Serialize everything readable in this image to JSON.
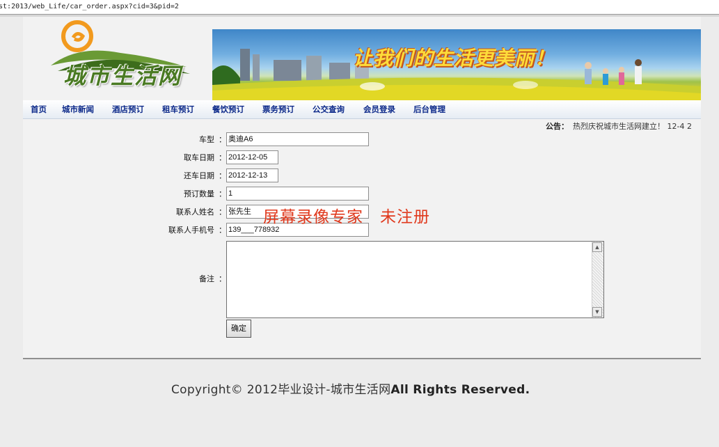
{
  "browser": {
    "address": "ost:2013/web_Life/car_order.aspx?cid=3&pid=2"
  },
  "header": {
    "logo_text": "城市生活网",
    "banner_slogan": "让我们的生活更美丽！"
  },
  "nav": {
    "items": [
      "首页",
      "城市新闻",
      "酒店预订",
      "租车预订",
      "餐饮预订",
      "票务预订",
      "公交查询",
      "会员登录",
      "后台管理"
    ]
  },
  "notice": {
    "label": "公告：",
    "text": "热烈庆祝城市生活网建立！ 12-4 2"
  },
  "form": {
    "colon": "：",
    "car_type": {
      "label": "车型",
      "value": "奥迪A6"
    },
    "pickup_date": {
      "label": "取车日期",
      "value": "2012-12-05"
    },
    "return_date": {
      "label": "还车日期",
      "value": "2012-12-13"
    },
    "quantity": {
      "label": "预订数量",
      "value": "1"
    },
    "contact_name": {
      "label": "联系人姓名",
      "value": "张先生"
    },
    "contact_phone": {
      "label": "联系人手机号",
      "value": "139___778932"
    },
    "remarks": {
      "label": "备注",
      "value": ""
    },
    "submit_label": "确定"
  },
  "watermark": "屏幕录像专家　未注册",
  "footer": {
    "copyright_prefix": "Copyright© 2012毕业设计-城市生活网",
    "copyright_suffix": "All Rights Reserved."
  }
}
